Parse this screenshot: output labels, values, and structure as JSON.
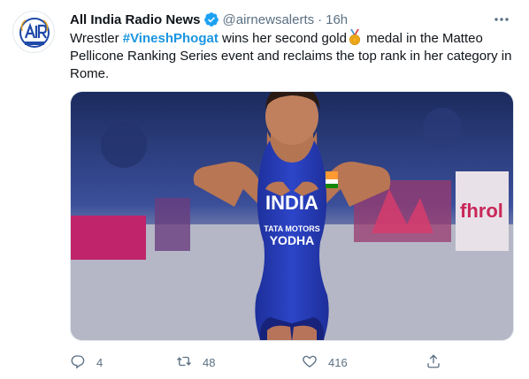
{
  "author": {
    "name": "All India Radio News",
    "handle": "@airnewsalerts",
    "separator": "·",
    "time": "16h"
  },
  "tweet": {
    "text_before": "Wrestler ",
    "hashtag": "#VineshPhogat",
    "text_middle": " wins her second gold",
    "text_after": " medal in the Matteo Pellicone Ranking Series event and reclaims the top rank in her category in Rome.",
    "medal_icon": "gold-medal-emoji"
  },
  "media": {
    "singlet_text": "INDIA",
    "sponsor_line1": "TATA MOTORS",
    "sponsor_line2": "YODHA"
  },
  "actions": {
    "replies": "4",
    "retweets": "48",
    "likes": "416"
  },
  "colors": {
    "link": "#1b95e0",
    "secondary_text": "#5b7083",
    "verified": "#1da1f2"
  }
}
